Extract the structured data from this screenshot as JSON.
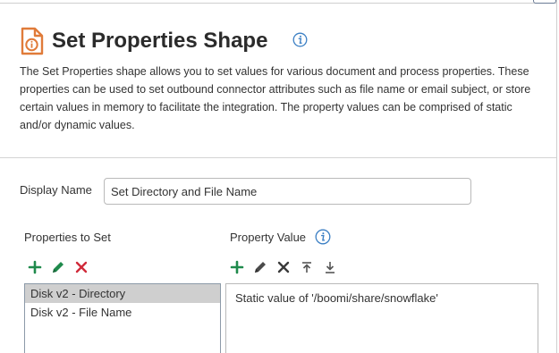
{
  "dialog": {
    "title": "Set Properties Shape",
    "description": "The Set Properties shape allows you to set values for various document and process properties. These properties can be used to set outbound connector attributes such as file name or email subject, or store certain values in memory to facilitate the integration. The property values can be comprised of static and/or dynamic values."
  },
  "form": {
    "display_name_label": "Display Name",
    "display_name_value": "Set Directory and File Name"
  },
  "properties": {
    "label": "Properties to Set",
    "items": [
      {
        "label": "Disk v2 - Directory",
        "selected": true
      },
      {
        "label": "Disk v2 - File Name",
        "selected": false
      }
    ]
  },
  "property_value": {
    "label": "Property Value",
    "items": [
      "Static value of '/boomi/share/snowflake'"
    ]
  },
  "icons": {
    "shape": "set-properties-shape-icon",
    "info": "info-icon",
    "add": "plus-icon",
    "edit": "pencil-icon",
    "delete": "close-icon",
    "move_top": "move-to-top-icon",
    "move_down": "move-down-icon"
  },
  "colors": {
    "shape_icon": "#e07b39",
    "info": "#3b7fc4",
    "add": "#1f8a4c",
    "edit": "#1f8a4c",
    "delete_left": "#d02a3a",
    "delete_right": "#3a3a3a",
    "selected_row": "#cfcfcf"
  }
}
